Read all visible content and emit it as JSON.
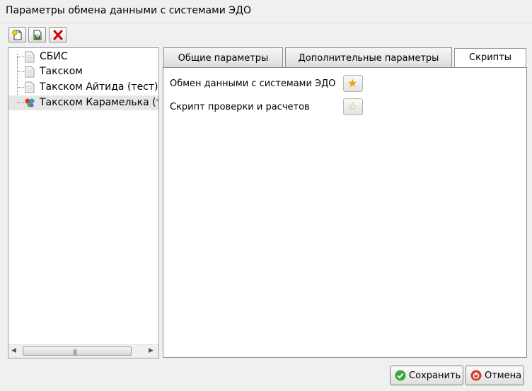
{
  "window": {
    "title": "Параметры обмена данными с системами ЭДО"
  },
  "toolbar": {
    "buttons": [
      {
        "icon": "add-document-icon"
      },
      {
        "icon": "save-icon"
      },
      {
        "icon": "delete-icon",
        "color": "#d00000"
      }
    ]
  },
  "tree": {
    "items": [
      {
        "label": "СБИС",
        "icon": "document-icon"
      },
      {
        "label": "Такском",
        "icon": "document-icon"
      },
      {
        "label": "Такском Айтида (тест)",
        "icon": "document-icon"
      },
      {
        "label": "Такском Карамелька (те",
        "icon": "colored-balls-icon",
        "selected": true
      }
    ]
  },
  "tabs": [
    {
      "label": "Общие параметры"
    },
    {
      "label": "Дополнительные параметры"
    },
    {
      "label": "Скрипты",
      "active": true
    }
  ],
  "scripts": {
    "rows": [
      {
        "label": "Обмен данными с системами ЭДО",
        "star": "filled"
      },
      {
        "label": "Скрипт проверки и расчетов",
        "star": "empty"
      }
    ]
  },
  "footer": {
    "save_label": "Сохранить",
    "cancel_label": "Отмена"
  },
  "colors": {
    "accent_star": "#f0a000",
    "save_green": "#3aa93a",
    "cancel_red": "#d03a2a"
  }
}
